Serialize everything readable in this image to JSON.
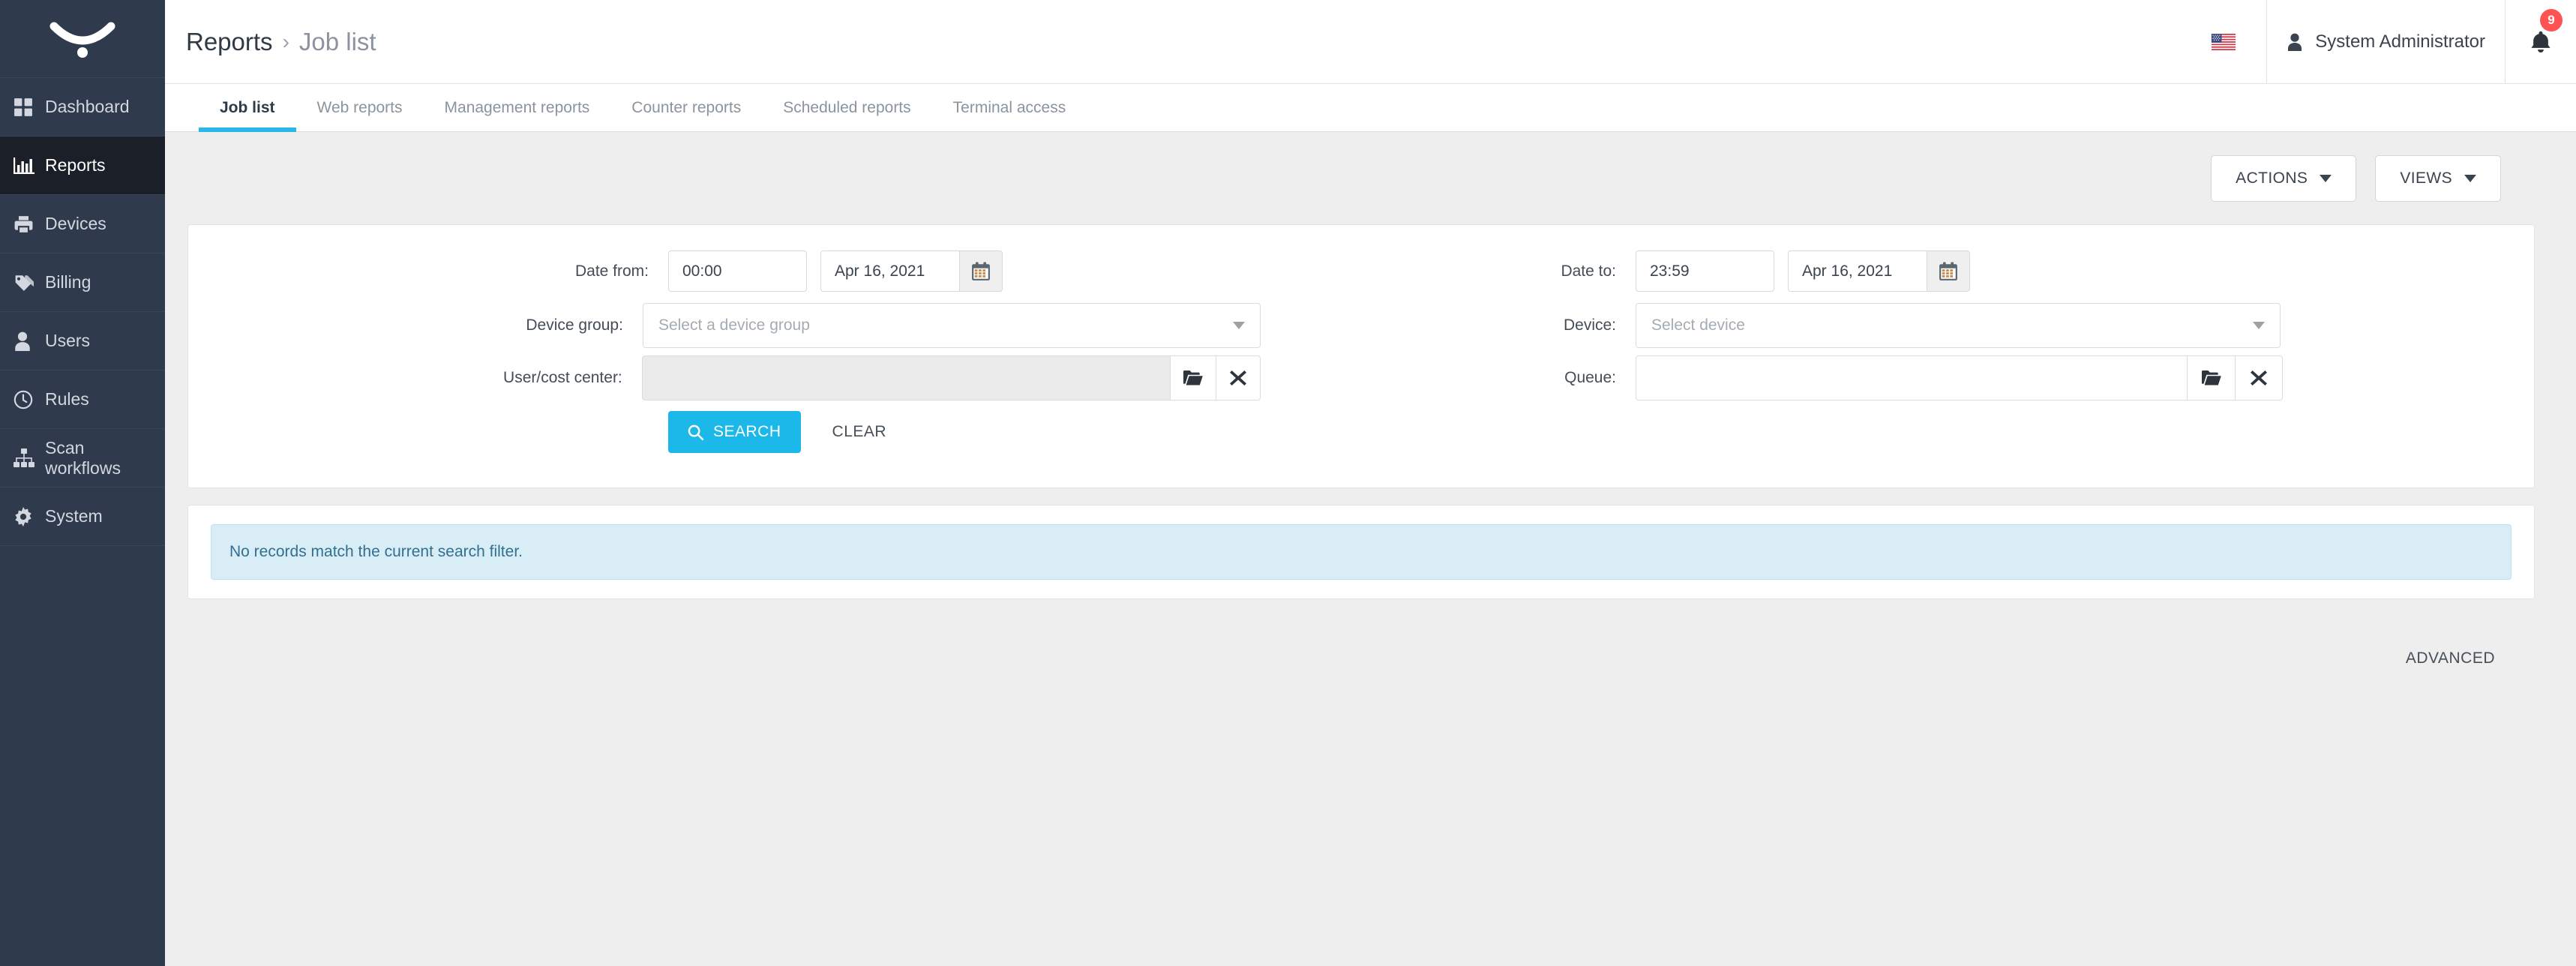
{
  "sidebar": {
    "logo_name": "myq-logo",
    "items": [
      {
        "label": "Dashboard",
        "icon": "grid-icon",
        "active": false
      },
      {
        "label": "Reports",
        "icon": "bar-chart-icon",
        "active": true
      },
      {
        "label": "Devices",
        "icon": "printer-icon",
        "active": false
      },
      {
        "label": "Billing",
        "icon": "tag-icon",
        "active": false
      },
      {
        "label": "Users",
        "icon": "user-icon",
        "active": false
      },
      {
        "label": "Rules",
        "icon": "clock-icon",
        "active": false
      },
      {
        "label": "Scan\nworkflows",
        "icon": "sitemap-icon",
        "active": false
      },
      {
        "label": "System",
        "icon": "gear-icon",
        "active": false
      }
    ]
  },
  "header": {
    "breadcrumb_root": "Reports",
    "breadcrumb_sep": "›",
    "breadcrumb_current": "Job list",
    "language_icon": "us-flag-icon",
    "user_icon": "user-icon",
    "user_name": "System Administrator",
    "bell_icon": "bell-icon",
    "notification_count": "9",
    "badge_color": "#ff5252"
  },
  "tabs": [
    {
      "label": "Job list",
      "active": true
    },
    {
      "label": "Web reports",
      "active": false
    },
    {
      "label": "Management reports",
      "active": false
    },
    {
      "label": "Counter reports",
      "active": false
    },
    {
      "label": "Scheduled reports",
      "active": false
    },
    {
      "label": "Terminal access",
      "active": false
    }
  ],
  "toolbar": {
    "actions_label": "ACTIONS",
    "views_label": "VIEWS"
  },
  "filter": {
    "date_from_label": "Date from:",
    "date_from_time": "00:00",
    "date_from_date": "Apr 16, 2021",
    "date_to_label": "Date to:",
    "date_to_time": "23:59",
    "date_to_date": "Apr 16, 2021",
    "calendar_icon": "calendar-icon",
    "device_group_label": "Device group:",
    "device_group_placeholder": "Select a device group",
    "device_label": "Device:",
    "device_placeholder": "Select device",
    "user_cost_center_label": "User/cost center:",
    "user_cost_center_value": "",
    "queue_label": "Queue:",
    "queue_value": "",
    "browse_icon": "folder-open-icon",
    "clear_field_icon": "close-icon",
    "search_label": "SEARCH",
    "search_icon": "search-icon",
    "clear_label": "CLEAR",
    "advanced_label": "ADVANCED",
    "accent_color": "#1cb8ea"
  },
  "result": {
    "empty_message": "No records match the current search filter.",
    "info_bg": "#d9edf7",
    "info_text_color": "#31708f"
  }
}
